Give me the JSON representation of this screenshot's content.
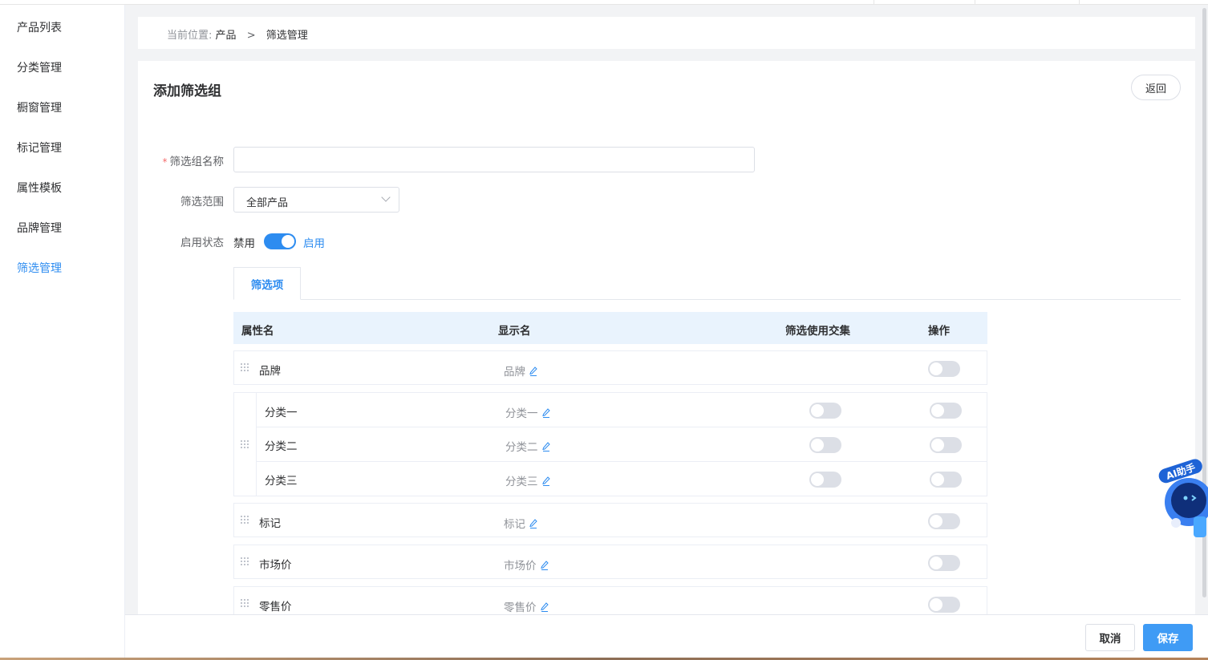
{
  "sidebar": {
    "items": [
      {
        "label": "产品列表",
        "active": false
      },
      {
        "label": "分类管理",
        "active": false
      },
      {
        "label": "橱窗管理",
        "active": false
      },
      {
        "label": "标记管理",
        "active": false
      },
      {
        "label": "属性模板",
        "active": false
      },
      {
        "label": "品牌管理",
        "active": false
      },
      {
        "label": "筛选管理",
        "active": true
      }
    ]
  },
  "breadcrumb": {
    "prefix": "当前位置:",
    "items": [
      "产品",
      "筛选管理"
    ],
    "separator": ">"
  },
  "page": {
    "title": "添加筛选组",
    "back_label": "返回"
  },
  "form": {
    "name_label": "筛选组名称",
    "name_required": "*",
    "name_value": "",
    "scope_label": "筛选范围",
    "scope_value": "全部产品",
    "status_label": "启用状态",
    "status_off_text": "禁用",
    "status_on_text": "启用",
    "status_enabled": true
  },
  "tabs": [
    {
      "label": "筛选项",
      "active": true
    }
  ],
  "table": {
    "headers": {
      "attr": "属性名",
      "display": "显示名",
      "intersect": "筛选使用交集",
      "action": "操作"
    },
    "rows": [
      {
        "name": "品牌",
        "display": "品牌",
        "intersect": null,
        "action_on": false
      },
      {
        "group": true,
        "children": [
          {
            "name": "分类一",
            "display": "分类一",
            "intersect": false,
            "action_on": false
          },
          {
            "name": "分类二",
            "display": "分类二",
            "intersect": false,
            "action_on": false
          },
          {
            "name": "分类三",
            "display": "分类三",
            "intersect": false,
            "action_on": false
          }
        ]
      },
      {
        "name": "标记",
        "display": "标记",
        "intersect": null,
        "action_on": false
      },
      {
        "name": "市场价",
        "display": "市场价",
        "intersect": null,
        "action_on": false
      },
      {
        "name": "零售价",
        "display": "零售价",
        "intersect": null,
        "action_on": false
      }
    ]
  },
  "footer": {
    "cancel_label": "取消",
    "save_label": "保存"
  },
  "ai_widget": {
    "label": "AI助手"
  },
  "colors": {
    "accent": "#2d8cf0",
    "save_button": "#3f9bf5",
    "table_header": "#e9f3fd"
  }
}
